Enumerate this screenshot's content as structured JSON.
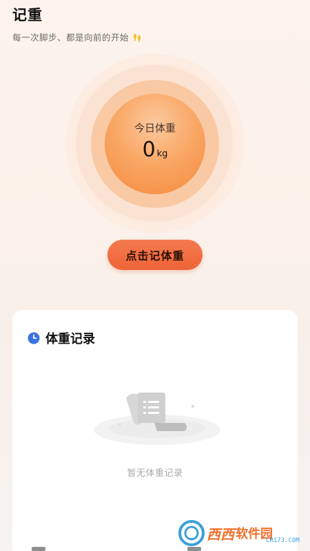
{
  "header": {
    "title": "记重",
    "subtitle": "每一次脚步、都是向前的开始"
  },
  "today": {
    "label": "今日体重",
    "value": "0",
    "unit": "kg"
  },
  "action": {
    "record_label": "点击记体重"
  },
  "records": {
    "title": "体重记录",
    "empty_text": "暂无体重记录"
  },
  "watermark": {
    "brand": "西西",
    "brand2": "软件园",
    "site": "CR173.COM"
  },
  "colors": {
    "accent": "#ee6437",
    "circle_core": "#f58a3c",
    "clock_icon": "#3b73e0"
  }
}
